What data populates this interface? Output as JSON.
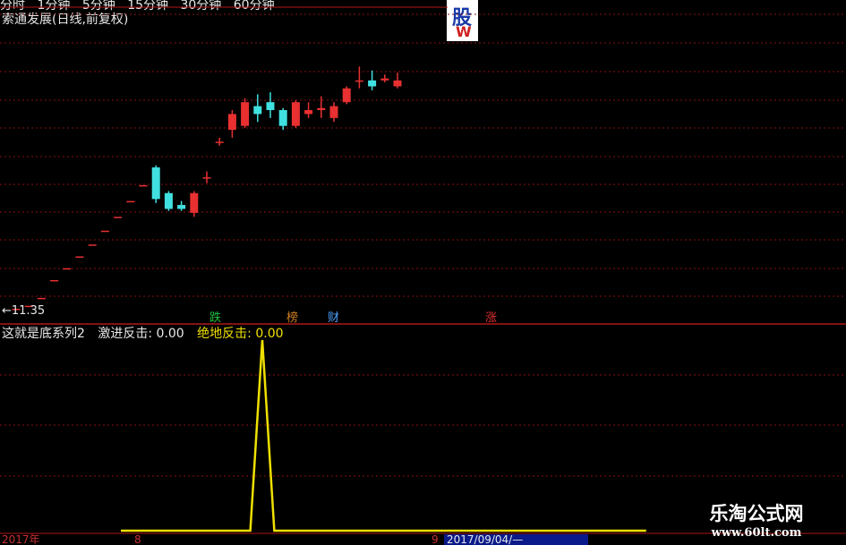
{
  "header": {
    "period_tabs": [
      "分时",
      "1分钟",
      "5分钟",
      "15分钟",
      "30分钟",
      "60分钟"
    ],
    "chart_title": "索通发展(日线,前复权)"
  },
  "logo": {
    "line1": "股",
    "line2": "W"
  },
  "price_panel": {
    "low_price_label": "←11.35",
    "tags": [
      {
        "text": "跌",
        "color": "#20c040"
      },
      {
        "text": "榜",
        "color": "#d08020"
      },
      {
        "text": "财",
        "color": "#4aa0ff"
      },
      {
        "text": "涨",
        "color": "#e03030"
      }
    ]
  },
  "indicator": {
    "name": "这就是底系列2",
    "value1": "激进反击: 0.00",
    "value2": "绝地反击: 0.00"
  },
  "time_axis": {
    "year": "2017年",
    "month8": "8",
    "month9": "9",
    "date": "2017/09/04/—"
  },
  "watermark": {
    "line1": "乐淘公式网",
    "line2": "www.60lt.com"
  },
  "colors": {
    "up": "#e83030",
    "down": "#40e0e0",
    "grid": "#8a1010",
    "indicator": "#f0e000"
  },
  "chart_data": {
    "type": "candlestick",
    "title": "索通发展(日线,前复权)",
    "min_price": 11.35,
    "candles": [
      {
        "o": 11.35,
        "c": 11.35,
        "h": 11.35,
        "l": 11.35
      },
      {
        "o": 11.5,
        "c": 11.5,
        "h": 11.5,
        "l": 11.5
      },
      {
        "o": 11.9,
        "c": 11.9,
        "h": 11.9,
        "l": 11.9
      },
      {
        "o": 12.8,
        "c": 12.8,
        "h": 12.8,
        "l": 12.8
      },
      {
        "o": 13.4,
        "c": 13.4,
        "h": 13.4,
        "l": 13.4
      },
      {
        "o": 14.0,
        "c": 14.0,
        "h": 14.0,
        "l": 14.0
      },
      {
        "o": 14.6,
        "c": 14.6,
        "h": 14.6,
        "l": 14.6
      },
      {
        "o": 15.3,
        "c": 15.3,
        "h": 15.3,
        "l": 15.3
      },
      {
        "o": 16.0,
        "c": 16.0,
        "h": 16.0,
        "l": 16.0
      },
      {
        "o": 16.8,
        "c": 16.8,
        "h": 16.8,
        "l": 16.8
      },
      {
        "o": 17.6,
        "c": 17.6,
        "h": 17.6,
        "l": 17.6
      },
      {
        "o": 18.5,
        "c": 16.9,
        "h": 18.6,
        "l": 16.7
      },
      {
        "o": 17.2,
        "c": 16.4,
        "h": 17.3,
        "l": 16.3
      },
      {
        "o": 16.6,
        "c": 16.4,
        "h": 16.8,
        "l": 16.3
      },
      {
        "o": 16.2,
        "c": 17.2,
        "h": 17.3,
        "l": 16.0
      },
      {
        "o": 18.0,
        "c": 18.0,
        "h": 18.3,
        "l": 17.7
      },
      {
        "o": 19.8,
        "c": 19.8,
        "h": 20.0,
        "l": 19.6
      },
      {
        "o": 20.4,
        "c": 21.2,
        "h": 21.4,
        "l": 20.0
      },
      {
        "o": 20.6,
        "c": 21.8,
        "h": 22.0,
        "l": 20.5
      },
      {
        "o": 21.6,
        "c": 21.2,
        "h": 22.2,
        "l": 20.8
      },
      {
        "o": 21.8,
        "c": 21.4,
        "h": 22.3,
        "l": 21.0
      },
      {
        "o": 21.4,
        "c": 20.6,
        "h": 21.5,
        "l": 20.4
      },
      {
        "o": 20.6,
        "c": 21.8,
        "h": 21.9,
        "l": 20.5
      },
      {
        "o": 21.2,
        "c": 21.4,
        "h": 21.8,
        "l": 21.0
      },
      {
        "o": 21.4,
        "c": 21.5,
        "h": 22.1,
        "l": 21.0
      },
      {
        "o": 21.0,
        "c": 21.6,
        "h": 21.8,
        "l": 20.8
      },
      {
        "o": 21.8,
        "c": 22.5,
        "h": 22.6,
        "l": 21.7
      },
      {
        "o": 22.9,
        "c": 22.9,
        "h": 23.6,
        "l": 22.5
      },
      {
        "o": 22.9,
        "c": 22.6,
        "h": 23.4,
        "l": 22.4
      },
      {
        "o": 22.9,
        "c": 23.0,
        "h": 23.2,
        "l": 22.8
      },
      {
        "o": 22.6,
        "c": 22.9,
        "h": 23.3,
        "l": 22.5
      }
    ],
    "indicator_series": {
      "name": "这就是底系列2",
      "values": [
        0,
        0,
        0,
        0,
        0,
        0,
        0,
        0,
        0,
        0,
        0,
        0,
        0,
        0,
        0,
        0,
        0,
        0,
        0,
        0,
        0,
        1,
        0,
        0,
        0,
        0,
        0,
        0,
        0,
        0,
        0,
        0,
        0,
        0,
        0,
        0,
        0,
        0,
        0,
        0,
        0,
        0,
        0,
        0,
        0,
        0,
        0,
        0,
        0,
        0,
        0,
        0,
        0,
        0
      ]
    }
  }
}
